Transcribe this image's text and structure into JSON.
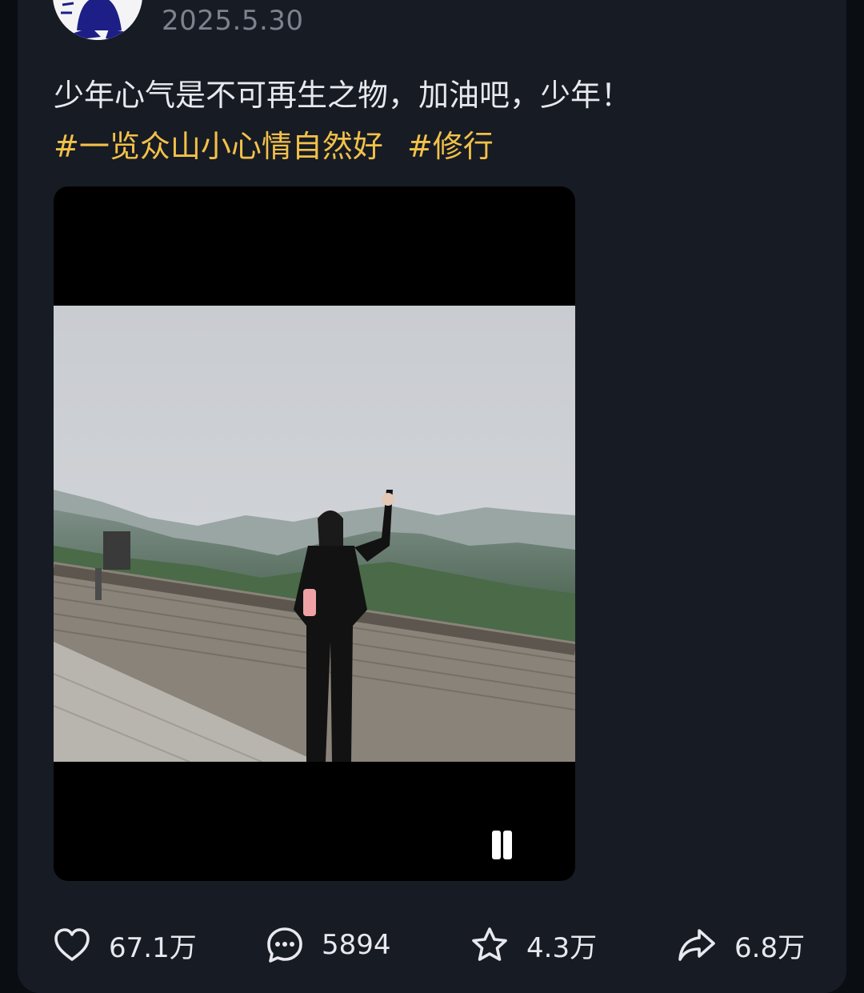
{
  "post": {
    "date": "2025.5.30",
    "text": "少年心气是不可再生之物，加油吧，少年！",
    "tags": [
      "#一览众山小心情自然好",
      "#修行"
    ]
  },
  "video": {
    "state": "playing",
    "control_icon": "pause-icon"
  },
  "actions": {
    "like": {
      "icon": "heart-icon",
      "count": "67.1万"
    },
    "comment": {
      "icon": "comment-bubble-icon",
      "count": "5894"
    },
    "favorite": {
      "icon": "star-icon",
      "count": "4.3万"
    },
    "share": {
      "icon": "share-arrow-icon",
      "count": "6.8万"
    }
  },
  "colors": {
    "background": "#171b24",
    "text": "#e7e9ee",
    "hashtag": "#f2c149",
    "date": "#7d828d"
  }
}
